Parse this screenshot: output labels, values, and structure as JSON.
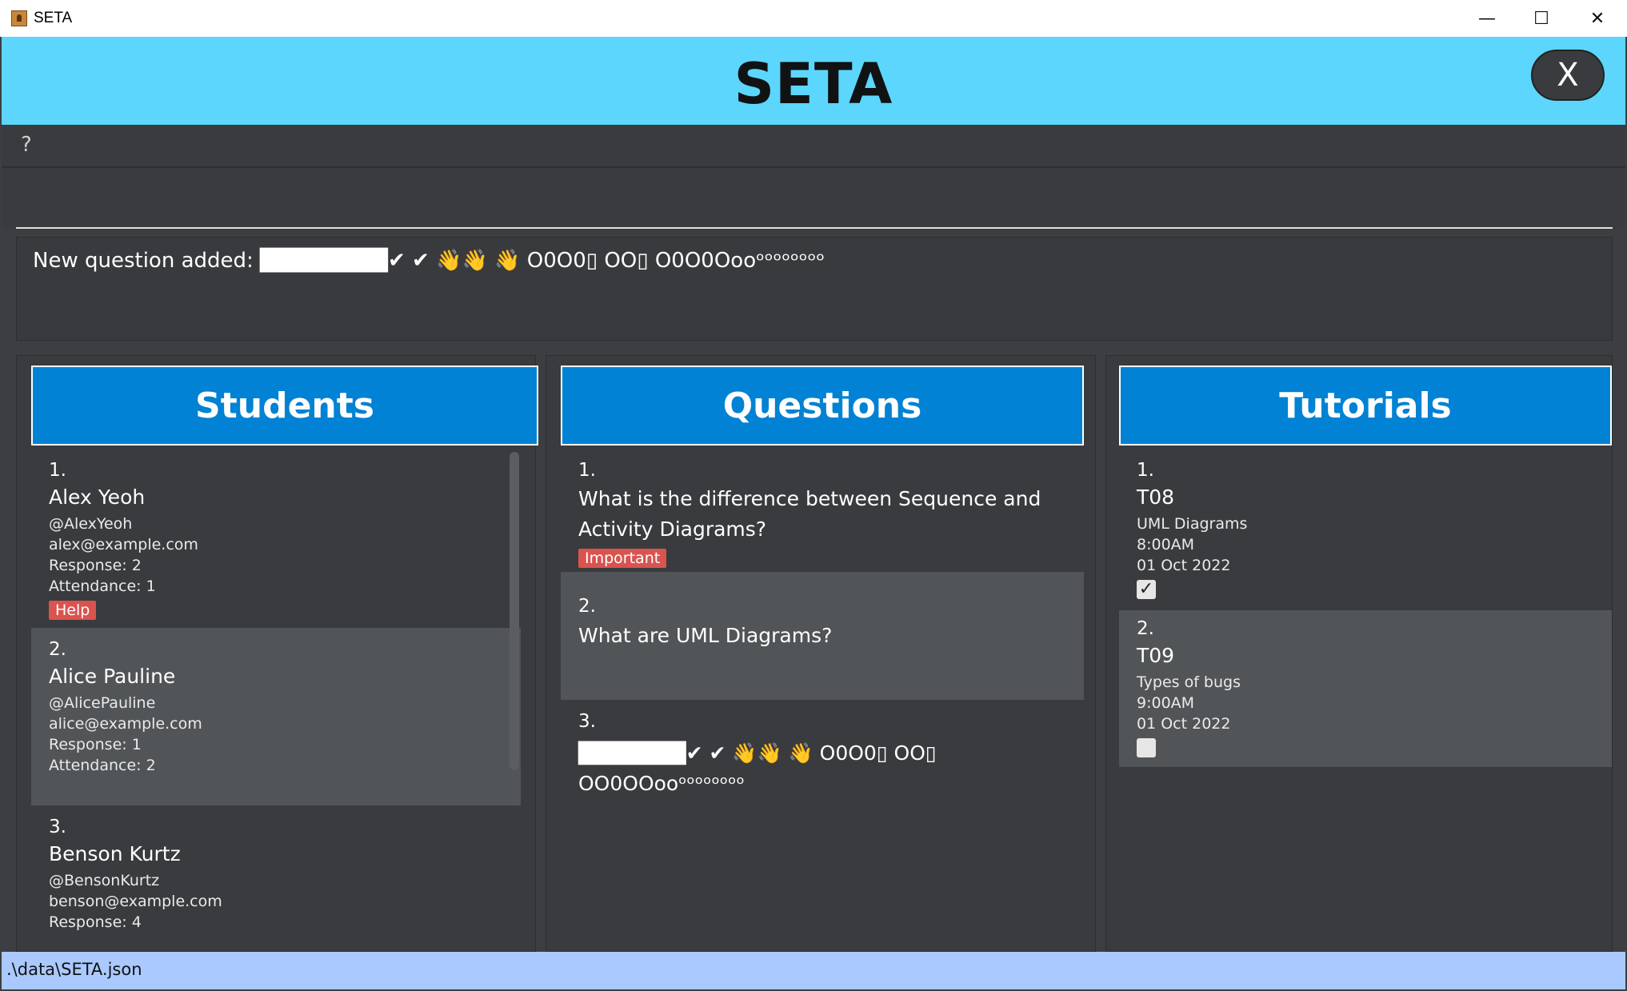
{
  "window": {
    "title": "SETA",
    "minimize_glyph": "—",
    "maximize_glyph": "☐",
    "close_glyph": "✕"
  },
  "header": {
    "title": "SETA",
    "exit_label": "X"
  },
  "menu": {
    "help_label": "?"
  },
  "command": {
    "value": "",
    "placeholder": ""
  },
  "result": {
    "message": "New question added: ████████✔ ✔ 👋👋 👋 O0O0▯ OO▯ O0O0Oooᵒᵒᵒᵒᵒᵒᵒᵒ"
  },
  "panels": {
    "students": {
      "title": "Students",
      "items": [
        {
          "index": "1.",
          "name": "Alex Yeoh",
          "handle": "@AlexYeoh",
          "email": "alex@example.com",
          "response": "Response: 2",
          "attendance": "Attendance: 1",
          "tag": "Help"
        },
        {
          "index": "2.",
          "name": "Alice Pauline",
          "handle": "@AlicePauline",
          "email": "alice@example.com",
          "response": "Response: 1",
          "attendance": "Attendance: 2",
          "tag": ""
        },
        {
          "index": "3.",
          "name": "Benson Kurtz",
          "handle": "@BensonKurtz",
          "email": "benson@example.com",
          "response": "Response: 4",
          "attendance": "",
          "tag": ""
        }
      ]
    },
    "questions": {
      "title": "Questions",
      "items": [
        {
          "index": "1.",
          "text": "What is the difference between Sequence and Activity Diagrams?",
          "tag": "Important"
        },
        {
          "index": "2.",
          "text": "What are UML Diagrams?",
          "tag": ""
        },
        {
          "index": "3.",
          "text": "███████✔ ✔ 👋👋 👋 O0O0▯ OO▯ OO0OOooᵒᵒᵒᵒᵒᵒᵒᵒ",
          "tag": ""
        }
      ]
    },
    "tutorials": {
      "title": "Tutorials",
      "items": [
        {
          "index": "1.",
          "name": "T08",
          "topic": "UML Diagrams",
          "time": "8:00AM",
          "date": "01 Oct 2022",
          "done": true
        },
        {
          "index": "2.",
          "name": "T09",
          "topic": "Types of bugs",
          "time": "9:00AM",
          "date": "01 Oct 2022",
          "done": false
        }
      ]
    }
  },
  "statusbar": {
    "path": ".\\data\\SETA.json"
  }
}
